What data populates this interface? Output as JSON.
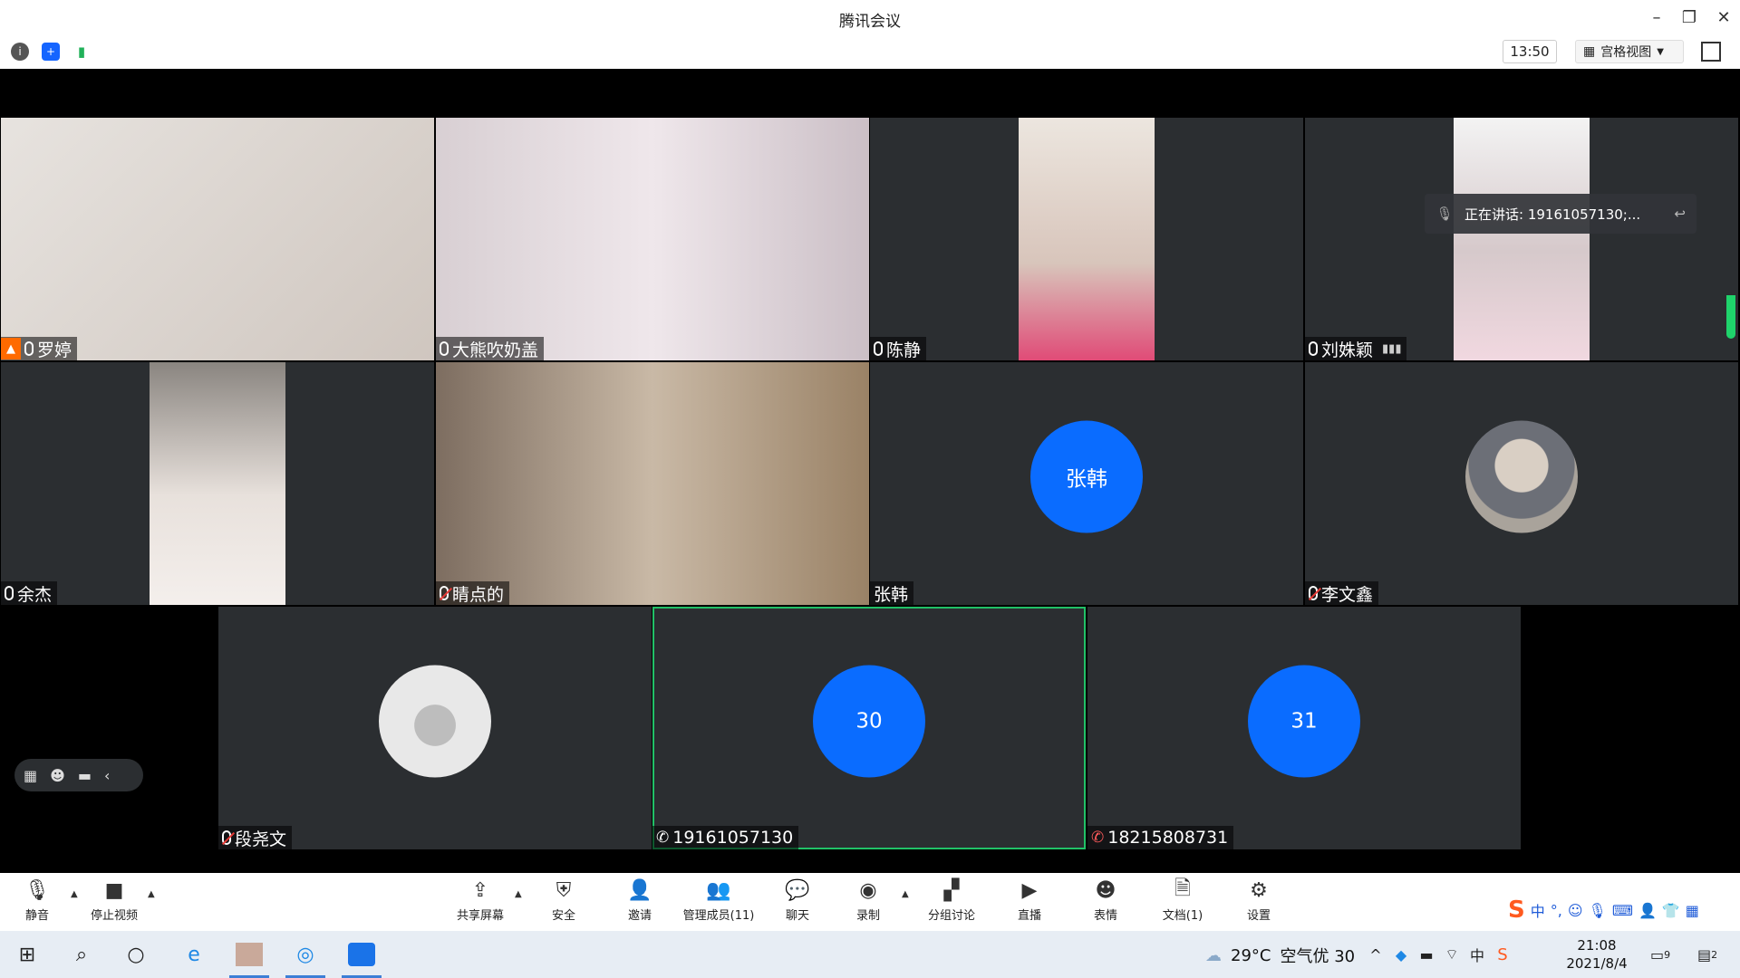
{
  "window": {
    "title": "腾讯会议"
  },
  "infobar": {
    "clock": "13:50",
    "view_label": "宫格视图"
  },
  "speaking": {
    "text": "正在讲话: 19161057130;..."
  },
  "participants": [
    {
      "name": "罗婷",
      "status": "mic"
    },
    {
      "name": "大熊吹奶盖",
      "status": "mic"
    },
    {
      "name": "陈静",
      "status": "mic"
    },
    {
      "name": "刘姝颖",
      "status": "mic"
    },
    {
      "name": "余杰",
      "status": "mic"
    },
    {
      "name": "睛点的",
      "status": "muted"
    },
    {
      "name": "张韩",
      "avatar": "张韩"
    },
    {
      "name": "李文鑫",
      "status": "muted"
    },
    {
      "name": "段尧文",
      "status": "muted"
    },
    {
      "name": "19161057130",
      "avatar": "30",
      "status": "phone"
    },
    {
      "name": "18215808731",
      "avatar": "31",
      "status": "phone-muted"
    }
  ],
  "toolbar": {
    "mute": "静音",
    "stop_video": "停止视频",
    "share": "共享屏幕",
    "security": "安全",
    "invite": "邀请",
    "members": "管理成员(11)",
    "chat": "聊天",
    "record": "录制",
    "breakout": "分组讨论",
    "live": "直播",
    "reactions": "表情",
    "docs": "文档(1)",
    "settings": "设置"
  },
  "ime": {
    "lang": "中"
  },
  "taskbar": {
    "weather_temp": "29°C",
    "weather_air": "空气优 30",
    "ime_lang": "中",
    "time": "21:08",
    "date": "2021/8/4",
    "badge1": "9",
    "badge2": "2"
  }
}
